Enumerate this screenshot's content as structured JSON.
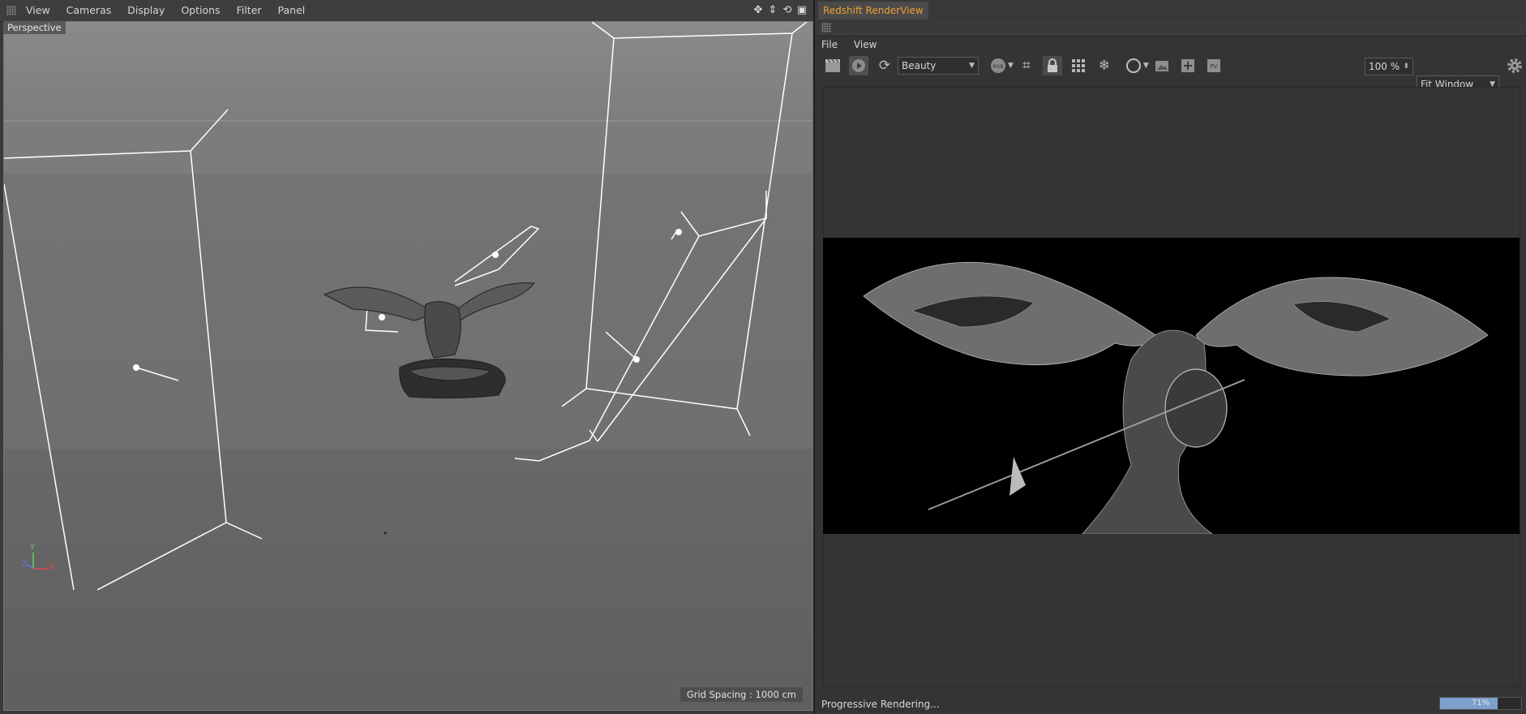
{
  "viewport_panel": {
    "menu": [
      "View",
      "Cameras",
      "Display",
      "Options",
      "Filter",
      "Panel"
    ],
    "view_label": "Perspective",
    "grid_spacing": "Grid Spacing : 1000 cm",
    "axis": {
      "y": "Y",
      "z": "Z",
      "x": "X"
    }
  },
  "renderview": {
    "tab_title": "Redshift RenderView",
    "menu": [
      "File",
      "View"
    ],
    "aov_select": "Beauty",
    "zoom_value": "100 %",
    "fit_select": "Fit Window",
    "status_text": "Progressive Rendering...",
    "progress": {
      "text": "71%",
      "fraction": 0.71
    }
  },
  "colors": {
    "accent": "#f0a030",
    "progress": "#7da0cc"
  },
  "icons": [
    "snapshot-icon",
    "play-icon",
    "refresh-icon",
    "rgb-icon",
    "crop-icon",
    "lock-icon",
    "grid-icon",
    "freeze-icon",
    "circle-icon",
    "image-icon",
    "add-icon",
    "pv-icon",
    "gear-icon"
  ]
}
